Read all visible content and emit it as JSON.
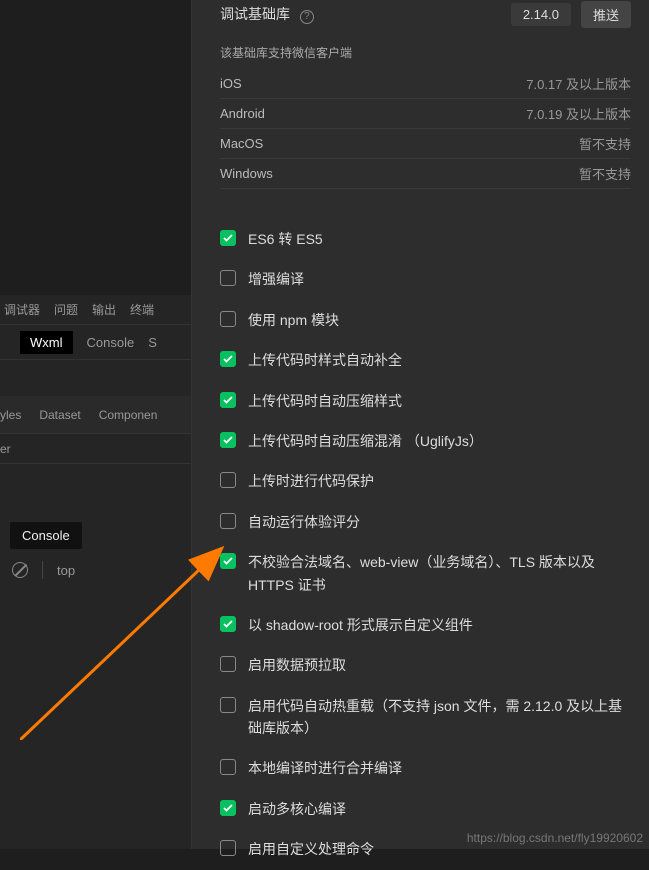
{
  "header": {
    "label_fragment": "调试基础库",
    "version": "2.14.0",
    "push": "推送"
  },
  "support": {
    "label": "该基础库支持微信客户端",
    "rows": [
      {
        "name": "iOS",
        "val": "7.0.17 及以上版本"
      },
      {
        "name": "Android",
        "val": "7.0.19 及以上版本"
      },
      {
        "name": "MacOS",
        "val": "暂不支持"
      },
      {
        "name": "Windows",
        "val": "暂不支持"
      }
    ]
  },
  "checkboxes": [
    {
      "checked": true,
      "label": "ES6 转 ES5"
    },
    {
      "checked": false,
      "label": "增强编译"
    },
    {
      "checked": false,
      "label": "使用 npm 模块"
    },
    {
      "checked": true,
      "label": "上传代码时样式自动补全"
    },
    {
      "checked": true,
      "label": "上传代码时自动压缩样式"
    },
    {
      "checked": true,
      "label": "上传代码时自动压缩混淆 （UglifyJs）"
    },
    {
      "checked": false,
      "label": "上传时进行代码保护"
    },
    {
      "checked": false,
      "label": "自动运行体验评分"
    },
    {
      "checked": true,
      "label": "不校验合法域名、web-view（业务域名）、TLS 版本以及 HTTPS 证书"
    },
    {
      "checked": true,
      "label": "以 shadow-root 形式展示自定义组件"
    },
    {
      "checked": false,
      "label": "启用数据预拉取"
    },
    {
      "checked": false,
      "label": "启用代码自动热重载（不支持 json 文件，需 2.12.0 及以上基础库版本）"
    },
    {
      "checked": false,
      "label": "本地编译时进行合并编译"
    },
    {
      "checked": true,
      "label": "启动多核心编译"
    },
    {
      "checked": false,
      "label": "启用自定义处理命令"
    }
  ],
  "left": {
    "tabs1": [
      "调试器",
      "问题",
      "输出",
      "终端"
    ],
    "tabs2": [
      "Wxml",
      "Console",
      "S"
    ],
    "tabs3": [
      "yles",
      "Dataset",
      "Componen"
    ],
    "er": "er",
    "console_chip": "Console",
    "top": "top"
  },
  "watermark": "https://blog.csdn.net/fly19920602"
}
